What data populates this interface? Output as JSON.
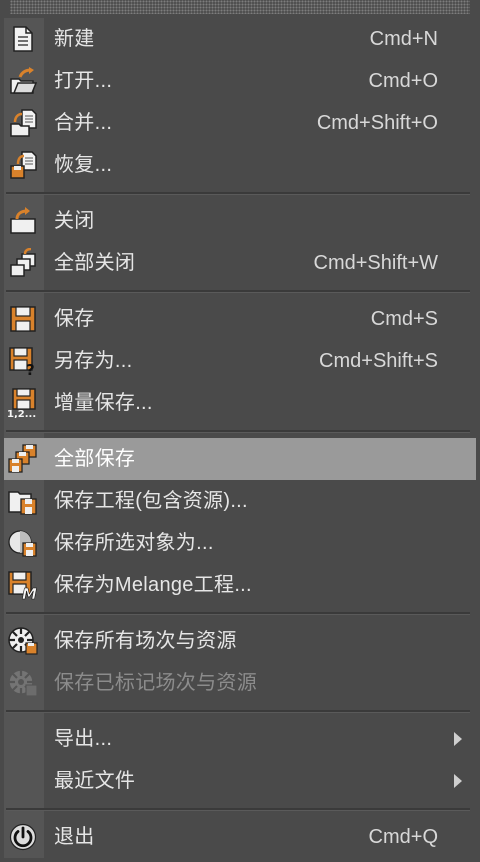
{
  "menu": {
    "items": [
      {
        "label": "新建",
        "shortcut": "Cmd+N",
        "icon": "new-document-icon"
      },
      {
        "label": "打开...",
        "shortcut": "Cmd+O",
        "icon": "open-folder-icon"
      },
      {
        "label": "合并...",
        "shortcut": "Cmd+Shift+O",
        "icon": "merge-icon"
      },
      {
        "label": "恢复...",
        "shortcut": "",
        "icon": "revert-icon"
      },
      {
        "label": "关闭",
        "shortcut": "",
        "icon": "close-icon"
      },
      {
        "label": "全部关闭",
        "shortcut": "Cmd+Shift+W",
        "icon": "close-all-icon"
      },
      {
        "label": "保存",
        "shortcut": "Cmd+S",
        "icon": "save-icon"
      },
      {
        "label": "另存为...",
        "shortcut": "Cmd+Shift+S",
        "icon": "save-as-icon"
      },
      {
        "label": "增量保存...",
        "shortcut": "",
        "icon": "incremental-save-icon"
      },
      {
        "label": "全部保存",
        "shortcut": "",
        "icon": "save-all-icon"
      },
      {
        "label": "保存工程(包含资源)...",
        "shortcut": "",
        "icon": "save-project-icon"
      },
      {
        "label": "保存所选对象为...",
        "shortcut": "",
        "icon": "save-selected-icon"
      },
      {
        "label": "保存为Melange工程...",
        "shortcut": "",
        "icon": "save-melange-icon"
      },
      {
        "label": "保存所有场次与资源",
        "shortcut": "",
        "icon": "save-all-takes-icon"
      },
      {
        "label": "保存已标记场次与资源",
        "shortcut": "",
        "icon": "save-marked-takes-icon"
      },
      {
        "label": "导出...",
        "shortcut": "",
        "icon": "submenu-arrow-icon"
      },
      {
        "label": "最近文件",
        "shortcut": "",
        "icon": "submenu-arrow-icon"
      },
      {
        "label": "退出",
        "shortcut": "Cmd+Q",
        "icon": "power-icon"
      }
    ],
    "highlighted": "全部保存",
    "disabled": [
      "保存已标记场次与资源"
    ],
    "colors": {
      "background": "#4a4a4a",
      "highlight": "#9a9a9a",
      "icon_orange": "#d9822b",
      "text": "#e6e6e6",
      "disabled_text": "#8c8c8c"
    }
  }
}
